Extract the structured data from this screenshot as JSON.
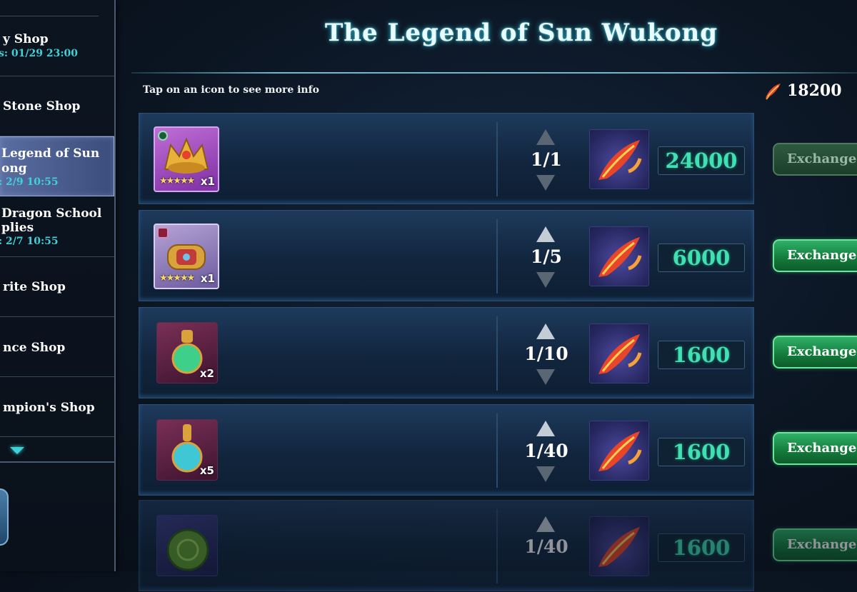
{
  "sidebar": {
    "items": [
      {
        "title": "y Shop",
        "sub": "s: 01/29 23:00",
        "active": false
      },
      {
        "title": "Stone Shop",
        "sub": "",
        "active": false
      },
      {
        "title": "Legend of Sun",
        "title2": "ong",
        "sub": ": 2/9 10:55",
        "active": true
      },
      {
        "title": "Dragon School",
        "title2": "plies",
        "sub": ": 2/7 10:55",
        "active": false
      },
      {
        "title": "rite Shop",
        "sub": "",
        "active": false
      },
      {
        "title": "nce Shop",
        "sub": "",
        "active": false
      },
      {
        "title": "mpion's Shop",
        "sub": "",
        "active": false
      }
    ]
  },
  "header": {
    "title": "The Legend of Sun Wukong",
    "info": "Tap on an icon to see more info",
    "currency_amount": "18200",
    "currency_icon": "phoenix-feather-icon"
  },
  "rows": [
    {
      "icon": "golden-crown-icon",
      "qty": "x1",
      "count": "1/1",
      "price": "24000",
      "button": "Exchange",
      "button_state": "disabled"
    },
    {
      "icon": "ornate-treasure-icon",
      "qty": "x1",
      "count": "1/5",
      "price": "6000",
      "button": "Exchange",
      "button_state": "enabled"
    },
    {
      "icon": "green-potion-flask-icon",
      "qty": "x2",
      "count": "1/10",
      "price": "1600",
      "button": "Exchange",
      "button_state": "enabled"
    },
    {
      "icon": "blue-potion-flask-icon",
      "qty": "x5",
      "count": "1/40",
      "price": "1600",
      "button": "Exchange",
      "button_state": "enabled"
    },
    {
      "icon": "green-medallion-icon",
      "qty": "",
      "count": "1/40",
      "price": "1600",
      "button": "Exchange",
      "button_state": "enabled"
    }
  ],
  "colors": {
    "accent": "#3fd1d8",
    "price": "#3fe0b2",
    "button": "#1f9a52"
  }
}
